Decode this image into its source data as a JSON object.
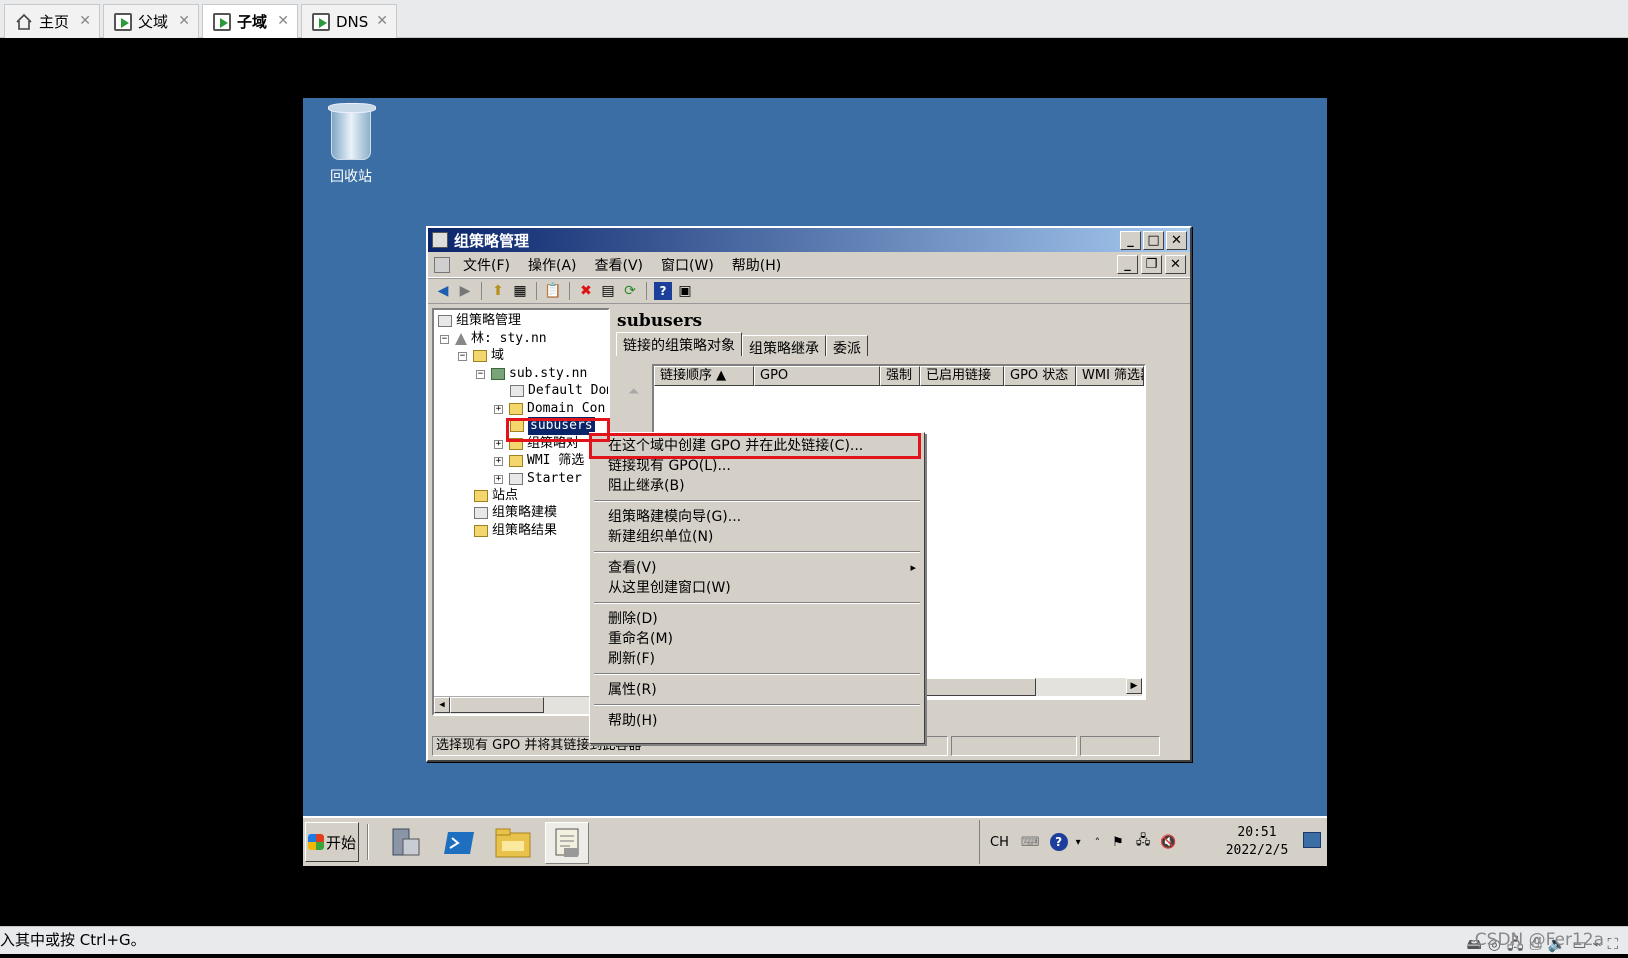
{
  "host_tabs": [
    {
      "label": "主页",
      "icon": "home-icon"
    },
    {
      "label": "父域",
      "icon": "vm-icon"
    },
    {
      "label": "子域",
      "icon": "vm-icon"
    },
    {
      "label": "DNS",
      "icon": "vm-icon"
    }
  ],
  "tab_close": "✕",
  "desktop": {
    "recycle_bin_label": "回收站"
  },
  "window": {
    "title": "组策略管理",
    "menu": [
      "文件(F)",
      "操作(A)",
      "查看(V)",
      "窗口(W)",
      "帮助(H)"
    ],
    "tree": {
      "root": "组策略管理",
      "forest": "林: sty.nn",
      "domains": "域",
      "domain": "sub.sty.nn",
      "default_policy": "Default Dom",
      "domain_controllers": "Domain Con",
      "subusers": "subusers",
      "gpo_objects": "组策略对",
      "wmi_filters": "WMI 筛选",
      "starter": "Starter",
      "sites": "站点",
      "modeling": "组策略建模",
      "results": "组策略结果"
    },
    "right_title": "subusers",
    "tabs": [
      "链接的组策略对象",
      "组策略继承",
      "委派"
    ],
    "columns": [
      "链接顺序 ▲",
      "GPO",
      "强制",
      "已启用链接",
      "GPO 状态",
      "WMI 筛选器"
    ],
    "status_text": "选择现有 GPO 并将其链接到此容器"
  },
  "context_menu": {
    "items": [
      "在这个域中创建 GPO 并在此处链接(C)...",
      "链接现有 GPO(L)...",
      "阻止继承(B)",
      "组策略建模向导(G)...",
      "新建组织单位(N)",
      "查看(V)",
      "从这里创建窗口(W)",
      "删除(D)",
      "重命名(M)",
      "刷新(F)",
      "属性(R)",
      "帮助(H)"
    ],
    "submenu_arrow": "▸",
    "highlighted_index": 0,
    "highlight_color": "#e1141c"
  },
  "taskbar": {
    "start_label": "开始",
    "lang": "CH",
    "time": "20:51",
    "date": "2022/2/5"
  },
  "host_status": {
    "hint": "入其中或按 Ctrl+G。",
    "watermark": "CSDN @Fer12a"
  }
}
